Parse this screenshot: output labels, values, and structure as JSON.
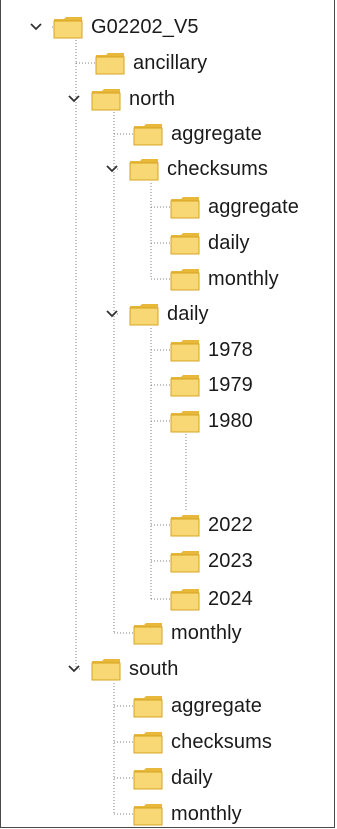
{
  "tree": {
    "root": {
      "label": "G02202_V5",
      "expanded": true
    },
    "nodes": [
      {
        "id": "ancillary",
        "label": "ancillary"
      },
      {
        "id": "north",
        "label": "north",
        "expanded": true
      },
      {
        "id": "north-aggregate",
        "label": "aggregate"
      },
      {
        "id": "north-checksums",
        "label": "checksums",
        "expanded": true
      },
      {
        "id": "north-checksums-aggregate",
        "label": "aggregate"
      },
      {
        "id": "north-checksums-daily",
        "label": "daily"
      },
      {
        "id": "north-checksums-monthly",
        "label": "monthly"
      },
      {
        "id": "north-daily",
        "label": "daily",
        "expanded": true
      },
      {
        "id": "north-daily-1978",
        "label": "1978"
      },
      {
        "id": "north-daily-1979",
        "label": "1979"
      },
      {
        "id": "north-daily-1980",
        "label": "1980"
      },
      {
        "id": "north-daily-2022",
        "label": "2022"
      },
      {
        "id": "north-daily-2023",
        "label": "2023"
      },
      {
        "id": "north-daily-2024",
        "label": "2024"
      },
      {
        "id": "north-monthly",
        "label": "monthly"
      },
      {
        "id": "south",
        "label": "south",
        "expanded": true
      },
      {
        "id": "south-aggregate",
        "label": "aggregate"
      },
      {
        "id": "south-checksums",
        "label": "checksums"
      },
      {
        "id": "south-daily",
        "label": "daily"
      },
      {
        "id": "south-monthly",
        "label": "monthly"
      }
    ]
  },
  "colors": {
    "folder_body": "#f8d775",
    "folder_tab": "#e8b83a",
    "folder_edge": "#d9a520",
    "guide_line": "#808080",
    "chevron": "#333333"
  },
  "icons": {
    "folder": "folder-icon",
    "expanded": "chevron-down-icon"
  }
}
